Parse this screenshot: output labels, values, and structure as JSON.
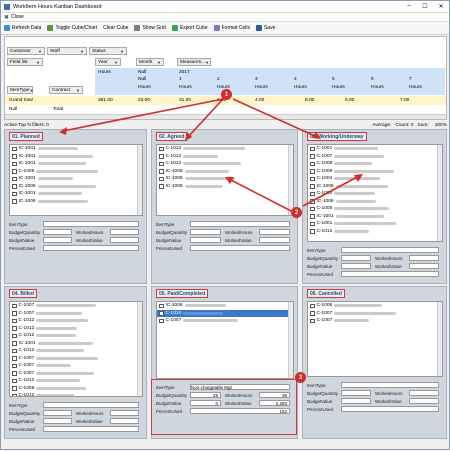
{
  "window": {
    "title": "WorkItem Hours Kanban Dashboard"
  },
  "menu": {
    "close_label": "Close"
  },
  "toolbar": {
    "refresh": "Refresh Data",
    "toggle": "Toggle Cube/Chart",
    "clear": "Clear Cube",
    "show_grid": "Show Grid",
    "export": "Export Cube",
    "format": "Format Cells",
    "save": "Save"
  },
  "pivot": {
    "filters": [
      "Customer",
      "Staff",
      "Status"
    ],
    "field_list": "Field list",
    "row_fields": [
      "ItemType",
      "Contract"
    ],
    "col_fields": [
      "Year",
      "Month",
      "Measures..."
    ],
    "col_header_hours": "Hours",
    "col_header_null": "Null",
    "col_header_2017": "2017",
    "col_months": [
      "Null",
      "1",
      "2",
      "3",
      "4",
      "5",
      "6",
      "7",
      "8"
    ],
    "col_sub": "Hours",
    "row_grand": "Grand total",
    "row_null": "Null",
    "row_total": "Total",
    "grand_values": [
      "381.00",
      "23.00",
      "31.00",
      "1.00",
      "4.00",
      "8.00",
      "5.00",
      "7.00"
    ]
  },
  "status": {
    "filters": "Active Top N filters: 0",
    "average": "Average:",
    "count": "Count: 0",
    "sum": "Sum:",
    "zoom": "100%"
  },
  "panels": [
    {
      "title": "01. Planned",
      "items": [
        "IC-1001",
        "IC-1001",
        "IC-1001",
        "C-1005",
        "IC-1001",
        "IC-1006",
        "IC-1001",
        "IC-1006"
      ]
    },
    {
      "title": "02. Agreed",
      "items": [
        "C-1012",
        "C-1012",
        "C-1012",
        "IC-1006",
        "IC-1006",
        "IC-1006"
      ]
    },
    {
      "title": "03. Working/Underway",
      "items": [
        "C-1001",
        "C-1007",
        "C-1008",
        "C-1009",
        "C-1004",
        "IC-1006",
        "C-1000",
        "IC-1006",
        "C-1005",
        "IC-1001",
        "C-1001",
        "C-1012"
      ]
    },
    {
      "title": "04. Billed",
      "items": [
        "C-1007",
        "C-1007",
        "C-1012",
        "C-1012",
        "C-1012",
        "IC-1001",
        "C-1012",
        "C-1007",
        "C-1007",
        "C-1007",
        "C-1012",
        "C-1009",
        "C-1012"
      ]
    },
    {
      "title": "05. Paid/Completed",
      "items": [
        "IC-1006",
        "C-1010",
        "C-1007"
      ]
    },
    {
      "title": "06. Cancelled",
      "items": [
        "C-1006",
        "C-1007",
        "C-1007"
      ]
    }
  ],
  "form_labels": {
    "itemtype": "ItemType",
    "budgetqty": "BudgetQuantity",
    "workedhours": "WorkedHours",
    "budgetvalue": "BudgetValue",
    "workedvalue": "WorkedValue",
    "percentused": "PercentUsed"
  },
  "paid_form": {
    "itemtype": "Non-chargeable Mgt",
    "budgetqty": "29",
    "workedhours": "38",
    "budgetvalue": "0",
    "workedvalue": "2,280",
    "percentused": "152"
  },
  "badges": [
    "1",
    "2",
    "3"
  ],
  "colors": {
    "accent": "#d23a3a",
    "panel": "#cfd6de",
    "header_blue": "#cfe2f7"
  }
}
